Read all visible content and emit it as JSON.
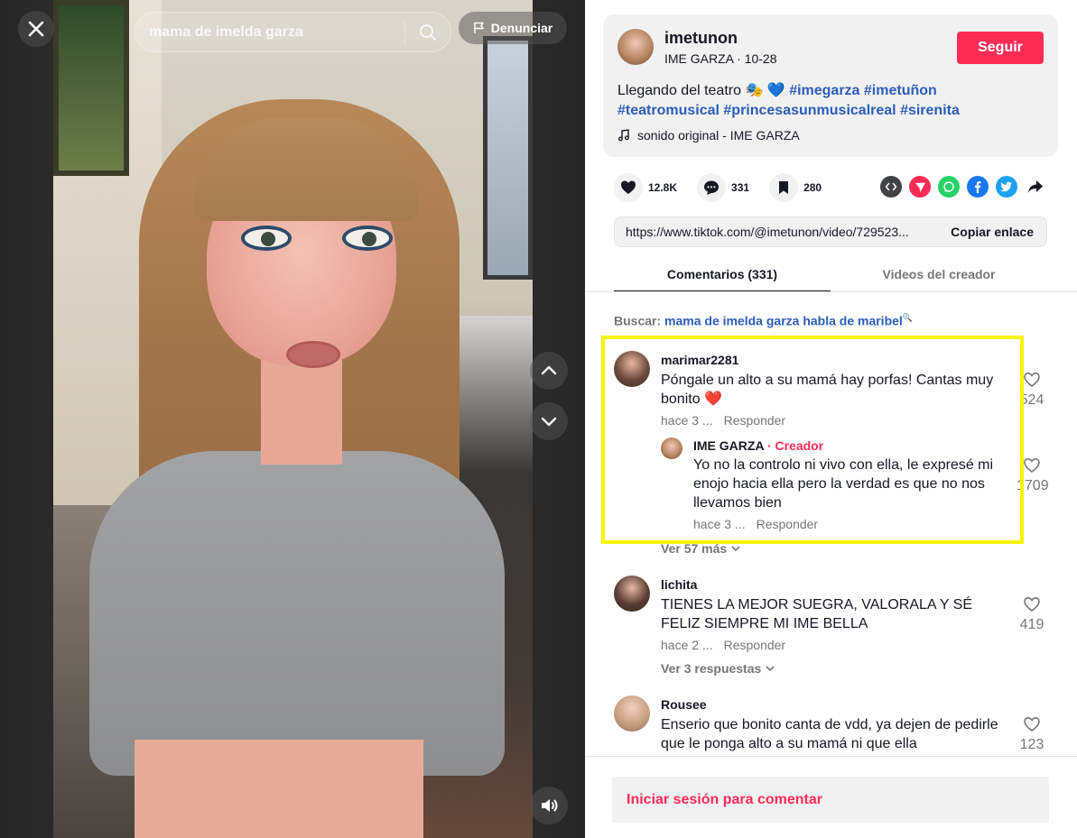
{
  "video": {
    "search": {
      "value": "mama de imelda garza"
    },
    "report_label": "Denunciar"
  },
  "post": {
    "username": "imetunon",
    "display_name": "IME GARZA",
    "date": "10-28",
    "follow_label": "Seguir",
    "description_text": "Llegando del teatro 🎭 💙",
    "hashtags": [
      "#imegarza",
      "#imetuñon",
      "#teatromusical",
      "#princesasunmusicalreal",
      "#sirenita"
    ],
    "music": "sonido original - IME GARZA"
  },
  "stats": {
    "likes": "12.8K",
    "comments": "331",
    "saves": "280"
  },
  "share_icons": [
    "embed-icon",
    "send-icon",
    "whatsapp-icon",
    "facebook-icon",
    "twitter-icon",
    "share-arrow-icon"
  ],
  "link": {
    "url": "https://www.tiktok.com/@imetunon/video/729523...",
    "copy_label": "Copiar enlace"
  },
  "tabs": {
    "comments": "Comentarios (331)",
    "creator_videos": "Videos del creador"
  },
  "search_hint": {
    "label": "Buscar:",
    "query": "mama de imelda garza habla de maribel"
  },
  "comments": [
    {
      "user": "marimar2281",
      "text": "Póngale un alto a su mamá hay porfas! Cantas muy bonito ❤️",
      "time": "hace 3 ...",
      "reply": "Responder",
      "likes": "524",
      "replies_label": "Ver 57 más",
      "creator_reply": {
        "user": "IME GARZA",
        "tag": "Creador",
        "text": "Yo no la controlo ni vivo con ella, le expresé mi enojo hacia ella pero la verdad es que no nos llevamos bien",
        "time": "hace 3 ...",
        "reply": "Responder",
        "likes": "1709"
      }
    },
    {
      "user": "lichita",
      "text": "TIENES LA MEJOR SUEGRA, VALORALA Y SÉ FELIZ SIEMPRE MI IME BELLA",
      "time": "hace 2 ...",
      "reply": "Responder",
      "likes": "419",
      "replies_label": "Ver 3 respuestas"
    },
    {
      "user": "Rousee",
      "text": "Enserio que bonito canta de vdd, ya dejen de pedirle que le ponga alto a su mamá ni que ella",
      "likes": "123"
    }
  ],
  "login_prompt": "Iniciar sesión para comentar",
  "colors": {
    "brand": "#fe2c55",
    "hashtag": "#2b5db9",
    "highlight": "#f5f500"
  }
}
